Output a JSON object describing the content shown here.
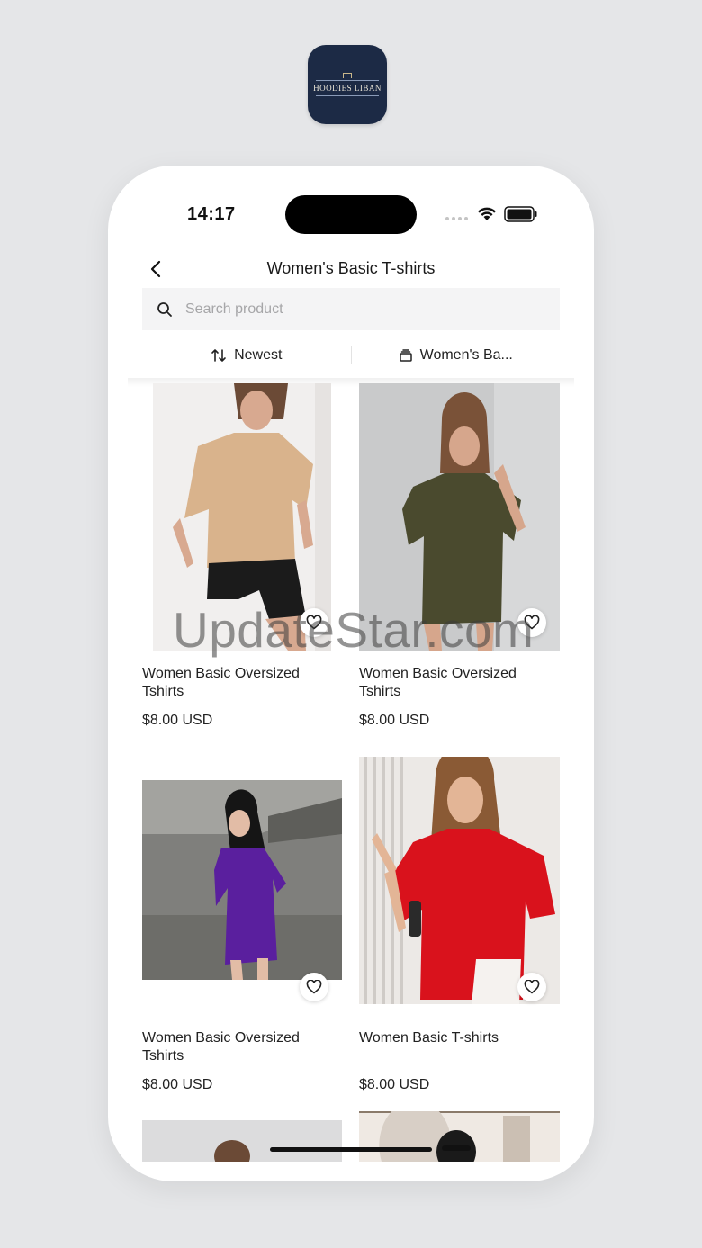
{
  "app_icon": {
    "brand": "HOODIES LIBAN"
  },
  "status_bar": {
    "time": "14:17"
  },
  "header": {
    "title": "Women's Basic T-shirts",
    "back_icon": "chevron-left-icon"
  },
  "search": {
    "placeholder": "Search product",
    "value": ""
  },
  "filters": {
    "sort_label": "Newest",
    "category_label": "Women's Ba..."
  },
  "products": [
    {
      "name": "Women Basic Oversized Tshirts",
      "price": "$8.00 USD",
      "shirt_color": "#d9b38c"
    },
    {
      "name": "Women Basic Oversized Tshirts",
      "price": "$8.00 USD",
      "shirt_color": "#4a4a2e"
    },
    {
      "name": "Women Basic Oversized Tshirts",
      "price": "$8.00 USD",
      "shirt_color": "#5a1f9e"
    },
    {
      "name": "Women Basic T-shirts",
      "price": "$8.00 USD",
      "shirt_color": "#d9121c"
    }
  ],
  "watermark": "UpdateStar.com"
}
